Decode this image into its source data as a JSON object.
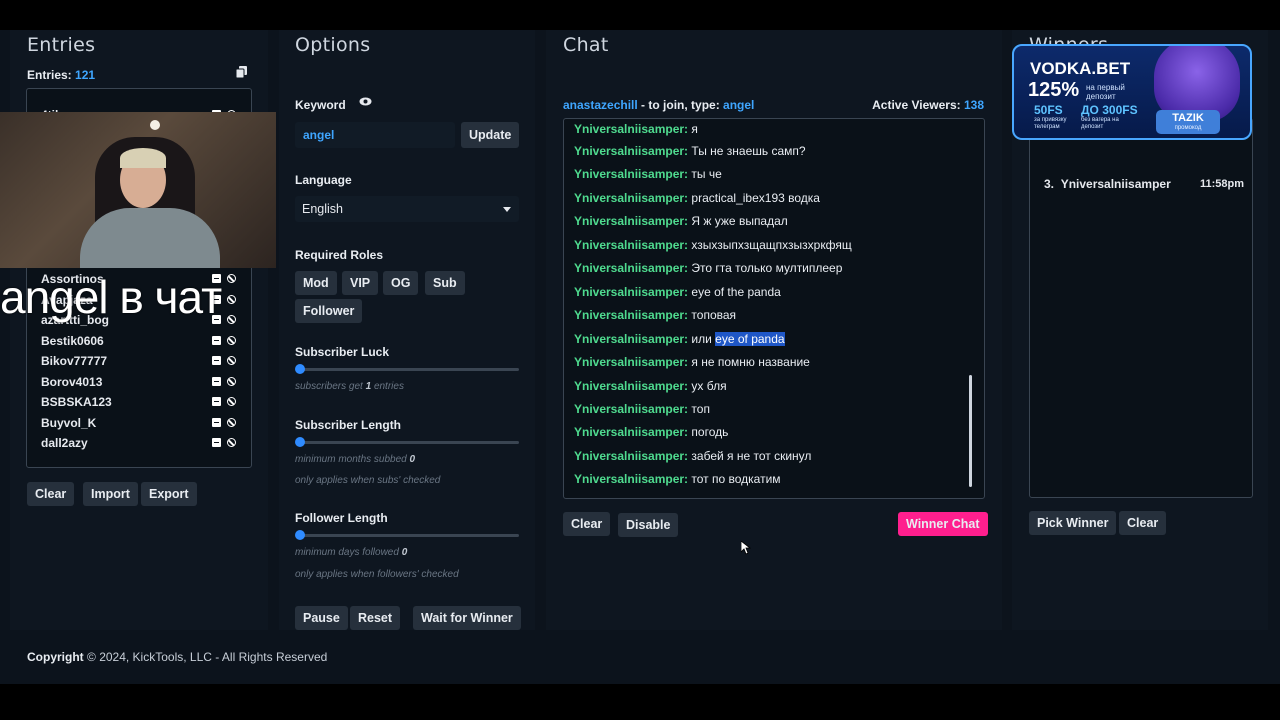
{
  "entries": {
    "title": "Entries",
    "count_label": "Entries:",
    "count": "121",
    "items": [
      "4tiko",
      "Assortinos",
      "Avapjaza",
      "azarttti_bog",
      "Bestik0606",
      "Bikov77777",
      "Borov4013",
      "BSBSKA123",
      "Buyvol_K",
      "dall2azy"
    ],
    "buttons": {
      "clear": "Clear",
      "import": "Import",
      "export": "Export"
    }
  },
  "options": {
    "title": "Options",
    "keyword_label": "Keyword",
    "keyword_value": "angel",
    "update_label": "Update",
    "language_label": "Language",
    "language_value": "English",
    "roles_label": "Required Roles",
    "roles": [
      "Mod",
      "VIP",
      "OG",
      "Sub",
      "Follower"
    ],
    "sub_luck_label": "Subscriber Luck",
    "sub_luck_hint_pre": "subscribers get",
    "sub_luck_value": "1",
    "sub_luck_hint_post": "entries",
    "sub_len_label": "Subscriber Length",
    "sub_len_hint_pre": "minimum months subbed",
    "sub_len_value": "0",
    "sub_len_hint2": "only applies when subs' checked",
    "fol_len_label": "Follower Length",
    "fol_len_hint_pre": "minimum days followed",
    "fol_len_value": "0",
    "fol_len_hint2": "only applies when followers' checked",
    "buttons": {
      "pause": "Pause",
      "reset": "Reset",
      "wait": "Wait for Winner"
    }
  },
  "chat": {
    "title": "Chat",
    "channel": "anastazechill",
    "join_text": "- to join, type:",
    "join_keyword": "angel",
    "viewers_label": "Active Viewers:",
    "viewers": "138",
    "top_partial_user": "Yniversalniisamper:",
    "top_partial_text": "я",
    "messages": [
      {
        "user": "Yniversalniisamper:",
        "text": "Ты не знаешь самп?"
      },
      {
        "user": "Yniversalniisamper:",
        "text": "ты че"
      },
      {
        "user": "Yniversalniisamper:",
        "text": "practical_ibex193 водка"
      },
      {
        "user": "Yniversalniisamper:",
        "text": "Я ж уже выпадал"
      },
      {
        "user": "Yniversalniisamper:",
        "text": "хзыхзыпхзщащпхзызхркфящ"
      },
      {
        "user": "Yniversalniisamper:",
        "text": "Это гта только мултиплеер"
      },
      {
        "user": "Yniversalniisamper:",
        "text": "eye of the panda"
      },
      {
        "user": "Yniversalniisamper:",
        "text": "топовая"
      },
      {
        "user": "Yniversalniisamper:",
        "text_pre": "или",
        "text_hl": "eye of panda"
      },
      {
        "user": "Yniversalniisamper:",
        "text": "я не помню название"
      },
      {
        "user": "Yniversalniisamper:",
        "text": "ух бля"
      },
      {
        "user": "Yniversalniisamper:",
        "text": "топ"
      },
      {
        "user": "Yniversalniisamper:",
        "text": "погодь"
      },
      {
        "user": "Yniversalniisamper:",
        "text": "забей я не тот скинул"
      },
      {
        "user": "Yniversalniisamper:",
        "text": "тот по водкатим"
      }
    ],
    "buttons": {
      "clear": "Clear",
      "disable": "Disable",
      "winner_chat": "Winner Chat"
    }
  },
  "winners": {
    "title": "Winners",
    "items": [
      {
        "rank": "3.",
        "name": "Yniversalniisamper",
        "time": "11:58pm"
      }
    ],
    "buttons": {
      "pick": "Pick Winner",
      "clear": "Clear"
    }
  },
  "footer": {
    "brand": "Copyright",
    "text": "© 2024, KickTools, LLC - All Rights Reserved"
  },
  "overlay": {
    "caption": "angel в чат",
    "ad_brand": "VODKA.BET",
    "ad_bonus": "125%",
    "ad_bonus_sub": "на первый депозит",
    "ad_fs": "50FS",
    "ad_fs_sub": "за привязку телеграм",
    "ad_fs2": "ДО 300FS",
    "ad_fs2_sub": "без вагера на депозит",
    "ad_promo": "TAZIK",
    "ad_promo_sub": "промокод"
  },
  "colors": {
    "accent_blue": "#3fa6ff",
    "username_green": "#4fdb8f",
    "winner_pink": "#ff1f8e",
    "bg": "#0c131c"
  }
}
